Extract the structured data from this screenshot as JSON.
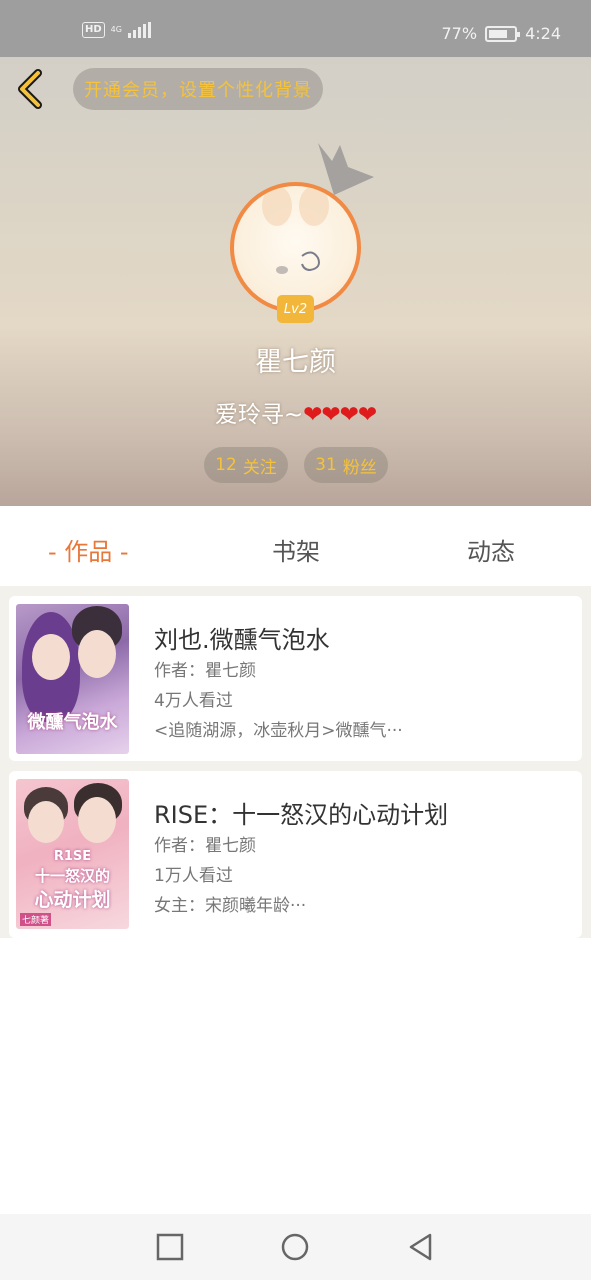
{
  "status_bar": {
    "hd": "HD",
    "network": "4G",
    "battery_percent_text": "77%",
    "battery_level": 0.77,
    "time": "4:24"
  },
  "header": {
    "vip_banner": "开通会员，设置个性化背景",
    "level": "Lv2",
    "username": "瞿七颜",
    "bio_text": "爱玲寻~",
    "bio_hearts": "❤❤❤❤",
    "follow_count": "12",
    "follow_label": "关注",
    "fans_count": "31",
    "fans_label": "粉丝"
  },
  "tabs": [
    {
      "label": "- 作品 -",
      "active": true
    },
    {
      "label": "书架",
      "active": false
    },
    {
      "label": "动态",
      "active": false
    }
  ],
  "works": [
    {
      "title": "刘也.微醺气泡水",
      "author": "作者：瞿七颜",
      "views": "4万人看过",
      "desc": "<追随湖源，冰壶秋月>微醺气···",
      "cover_text": "微醺气泡水"
    },
    {
      "title": "RISE：十一怒汉的心动计划",
      "author": "作者：瞿七颜",
      "views": "1万人看过",
      "desc": "女主：宋颜曦年龄···",
      "cover_text_1": "R1SE",
      "cover_text_2": "十一怒汉的",
      "cover_text_3": "心动计划",
      "cover_author": "七颜著"
    }
  ],
  "colors": {
    "accent_orange": "#e8773a",
    "gold": "#f5c23a",
    "heart_red": "#e01b1b"
  },
  "icons": {
    "back": "chevron-left-icon",
    "nav_square": "recent-apps-icon",
    "nav_circle": "home-icon",
    "nav_back": "back-triangle-icon"
  }
}
